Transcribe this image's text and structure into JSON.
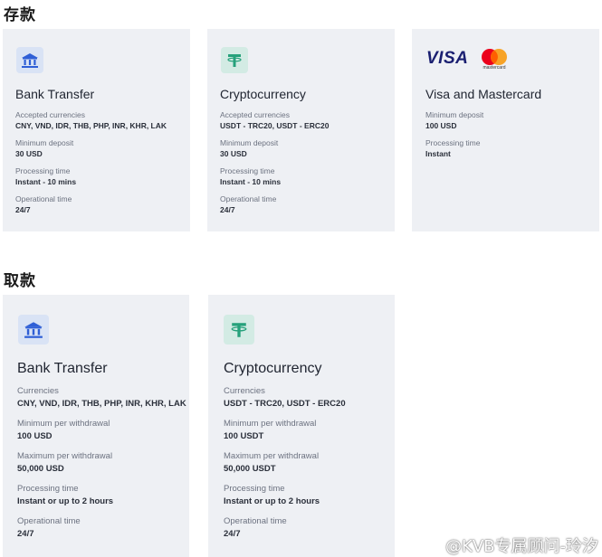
{
  "deposit": {
    "title": "存款",
    "cards": [
      {
        "title": "Bank Transfer",
        "icon": "bank-icon",
        "fields": [
          {
            "label": "Accepted currencies",
            "value": "CNY, VND, IDR, THB, PHP, INR, KHR, LAK"
          },
          {
            "label": "Minimum deposit",
            "value": "30 USD"
          },
          {
            "label": "Processing time",
            "value": "Instant - 10 mins"
          },
          {
            "label": "Operational time",
            "value": "24/7"
          }
        ]
      },
      {
        "title": "Cryptocurrency",
        "icon": "tether-icon",
        "fields": [
          {
            "label": "Accepted currencies",
            "value": "USDT - TRC20, USDT - ERC20"
          },
          {
            "label": "Minimum deposit",
            "value": "30 USD"
          },
          {
            "label": "Processing time",
            "value": "Instant - 10 mins"
          },
          {
            "label": "Operational time",
            "value": "24/7"
          }
        ]
      },
      {
        "title": "Visa and Mastercard",
        "visa_text": "VISA",
        "mastercard_text": "mastercard",
        "fields": [
          {
            "label": "Minimum deposit",
            "value": "100 USD"
          },
          {
            "label": "Processing time",
            "value": "Instant"
          }
        ]
      }
    ]
  },
  "withdrawal": {
    "title": "取款",
    "cards": [
      {
        "title": "Bank Transfer",
        "icon": "bank-icon",
        "fields": [
          {
            "label": "Currencies",
            "value": "CNY, VND, IDR, THB, PHP, INR, KHR, LAK"
          },
          {
            "label": "Minimum per withdrawal",
            "value": "100 USD"
          },
          {
            "label": "Maximum per withdrawal",
            "value": "50,000 USD"
          },
          {
            "label": "Processing time",
            "value": "Instant or up to 2 hours"
          },
          {
            "label": "Operational time",
            "value": "24/7"
          }
        ]
      },
      {
        "title": "Cryptocurrency",
        "icon": "tether-icon",
        "fields": [
          {
            "label": "Currencies",
            "value": "USDT - TRC20, USDT - ERC20"
          },
          {
            "label": "Minimum per withdrawal",
            "value": "100 USDT"
          },
          {
            "label": "Maximum per withdrawal",
            "value": "50,000 USDT"
          },
          {
            "label": "Processing time",
            "value": "Instant or up to 2 hours"
          },
          {
            "label": "Operational time",
            "value": "24/7"
          }
        ]
      }
    ]
  },
  "watermark": "@KVB专属顾问-玲汐",
  "colors": {
    "card_bg": "#eef0f4",
    "bank_icon": "#2f5fd6",
    "tether_icon": "#26a17b",
    "visa_blue": "#1a1f71",
    "mc_red": "#eb001b",
    "mc_yellow": "#f79e1b"
  }
}
